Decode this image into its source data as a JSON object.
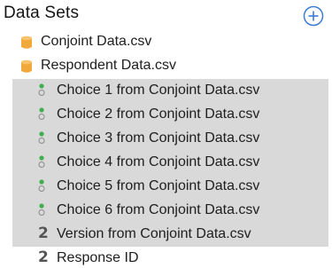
{
  "panel": {
    "title": "Data Sets",
    "add_icon": "plus-circle-icon",
    "accent_color": "#3a7bd5"
  },
  "files": [
    {
      "name": "Conjoint Data.csv",
      "icon": "database-cylinder-icon",
      "icon_color": "#f2a93b"
    },
    {
      "name": "Respondent Data.csv",
      "icon": "database-cylinder-icon",
      "icon_color": "#f2a93b"
    }
  ],
  "variables": [
    {
      "name": "Choice 1 from Conjoint Data.csv",
      "icon": "categorical-variable-icon",
      "selected": true
    },
    {
      "name": "Choice 2 from Conjoint Data.csv",
      "icon": "categorical-variable-icon",
      "selected": true
    },
    {
      "name": "Choice 3 from Conjoint Data.csv",
      "icon": "categorical-variable-icon",
      "selected": true
    },
    {
      "name": "Choice 4 from Conjoint Data.csv",
      "icon": "categorical-variable-icon",
      "selected": true
    },
    {
      "name": "Choice 5 from Conjoint Data.csv",
      "icon": "categorical-variable-icon",
      "selected": true
    },
    {
      "name": "Choice 6 from Conjoint Data.csv",
      "icon": "categorical-variable-icon",
      "selected": true
    },
    {
      "name": "Version from Conjoint Data.csv",
      "icon": "numeric-variable-icon",
      "icon_text": "2",
      "selected": true
    },
    {
      "name": "Response ID",
      "icon": "numeric-variable-icon",
      "icon_text": "2",
      "selected": false
    }
  ],
  "colors": {
    "selection_bg": "#d9d9d9",
    "categorical_dot": "#3fae4f"
  }
}
